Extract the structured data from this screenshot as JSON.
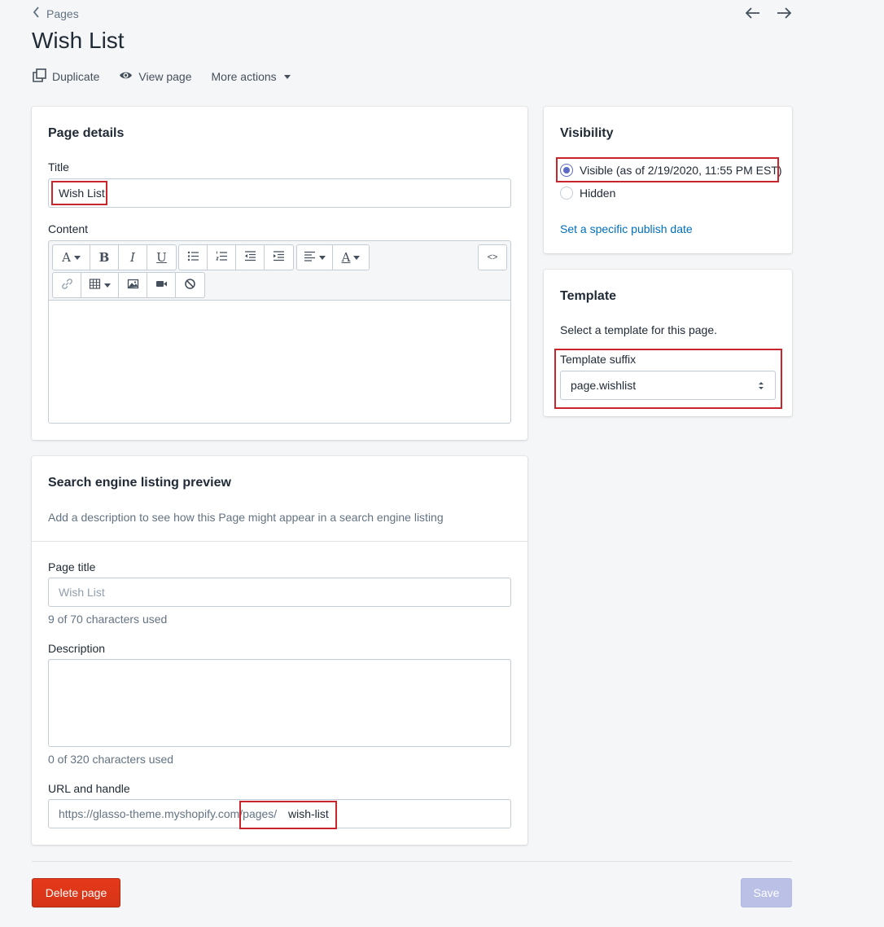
{
  "header": {
    "breadcrumb": "Pages",
    "title": "Wish List",
    "actions": {
      "duplicate": "Duplicate",
      "view_page": "View page",
      "more_actions": "More actions"
    }
  },
  "page_details": {
    "heading": "Page details",
    "title_label": "Title",
    "title_value": "Wish List",
    "content_label": "Content",
    "content_value": "",
    "toolbar_icons": [
      "font-icon",
      "bold-icon",
      "italic-icon",
      "underline-icon",
      "bullet-list-icon",
      "numbered-list-icon",
      "outdent-icon",
      "indent-icon",
      "align-icon",
      "text-color-icon",
      "code-icon",
      "link-icon",
      "table-icon",
      "image-icon",
      "video-icon",
      "clear-format-icon"
    ],
    "toolbar_glyphs": {
      "bold": "B",
      "italic": "I",
      "underline": "U",
      "code": "<>"
    }
  },
  "seo": {
    "heading": "Search engine listing preview",
    "description_text": "Add a description to see how this Page might appear in a search engine listing",
    "page_title_label": "Page title",
    "page_title_placeholder": "Wish List",
    "page_title_help": "9 of 70 characters used",
    "description_label": "Description",
    "description_help": "0 of 320 characters used",
    "url_label": "URL and handle",
    "url_prefix": "https://glasso-theme.myshopify.com/pages/",
    "url_handle": "wish-list"
  },
  "visibility": {
    "heading": "Visibility",
    "options": [
      {
        "label": "Visible (as of 2/19/2020, 11:55 PM EST)",
        "checked": true
      },
      {
        "label": "Hidden",
        "checked": false
      }
    ],
    "publish_link": "Set a specific publish date"
  },
  "template": {
    "heading": "Template",
    "help": "Select a template for this page.",
    "suffix_label": "Template suffix",
    "suffix_value": "page.wishlist"
  },
  "footer": {
    "delete_label": "Delete page",
    "save_label": "Save"
  },
  "colors": {
    "accent": "#5c6ac4",
    "danger": "#de3618",
    "link": "#006fbb",
    "highlight_box": "#c9252c"
  }
}
